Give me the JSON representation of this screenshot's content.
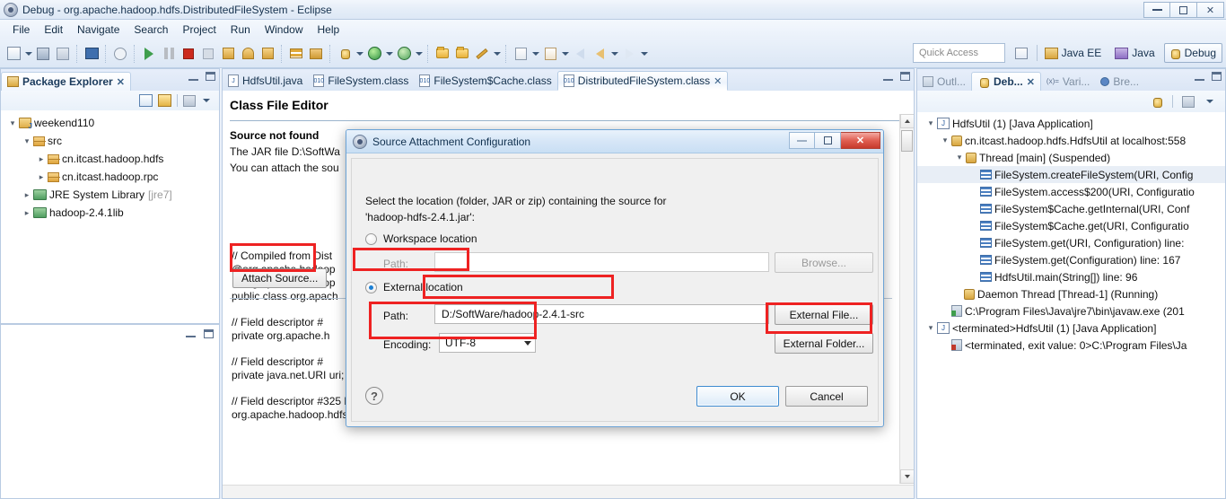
{
  "window": {
    "title": "Debug - org.apache.hadoop.hdfs.DistributedFileSystem - Eclipse",
    "icon": "eclipse-icon",
    "buttons": {
      "minimize": "—",
      "restore": "❐",
      "close": "✕"
    }
  },
  "menubar": {
    "items": [
      {
        "label": "File"
      },
      {
        "label": "Edit"
      },
      {
        "label": "Navigate"
      },
      {
        "label": "Search"
      },
      {
        "label": "Project"
      },
      {
        "label": "Run"
      },
      {
        "label": "Window"
      },
      {
        "label": "Help"
      }
    ]
  },
  "toolbar": {
    "quick_access_placeholder": "Quick Access",
    "perspectives": [
      {
        "label": "Java EE",
        "active": false,
        "icon": "javaee-perspective-icon"
      },
      {
        "label": "Java",
        "active": false,
        "icon": "java-perspective-icon"
      },
      {
        "label": "Debug",
        "active": true,
        "icon": "debug-perspective-icon"
      }
    ],
    "open_perspective_icon": "open-perspective-icon"
  },
  "package_explorer": {
    "tab_label": "Package Explorer",
    "tab_icon": "package-explorer-icon",
    "toolbar_icons": [
      "collapse-all-icon",
      "link-with-editor-icon",
      "view-menu-icon",
      "view-dropdown-icon"
    ],
    "tree": [
      {
        "label": "weekend110",
        "indent": 0,
        "twisty": "expanded",
        "icon": "java-project-icon",
        "suffix": ""
      },
      {
        "label": "src",
        "indent": 1,
        "twisty": "expanded",
        "icon": "source-folder-icon",
        "suffix": ""
      },
      {
        "label": "cn.itcast.hadoop.hdfs",
        "indent": 2,
        "twisty": "collapsed",
        "icon": "package-icon",
        "suffix": ""
      },
      {
        "label": "cn.itcast.hadoop.rpc",
        "indent": 2,
        "twisty": "collapsed",
        "icon": "package-icon",
        "suffix": ""
      },
      {
        "label": "JRE System Library",
        "indent": 1,
        "twisty": "collapsed",
        "icon": "library-icon",
        "suffix": "[jre7]"
      },
      {
        "label": "hadoop-2.4.1lib",
        "indent": 1,
        "twisty": "collapsed",
        "icon": "library-icon",
        "suffix": ""
      }
    ]
  },
  "editor": {
    "tabs": [
      {
        "label": "HdfsUtil.java",
        "icon": "java-file-icon",
        "active": false,
        "closable": false
      },
      {
        "label": "FileSystem.class",
        "icon": "class-file-icon",
        "active": false,
        "closable": false
      },
      {
        "label": "FileSystem$Cache.class",
        "icon": "class-file-icon",
        "active": false,
        "closable": false
      },
      {
        "label": "DistributedFileSystem.class",
        "icon": "class-file-icon",
        "active": true,
        "closable": true
      }
    ],
    "title": "Class File Editor",
    "section_heading": "Source not found",
    "info_lines": [
      "The JAR file D:\\SoftWa",
      "You can attach the sou"
    ],
    "attach_source_button": "Attach Source...",
    "code_lines": [
      "// Compiled from Dist",
      "@org.apache.hadoop",
      "@org.apache.hadoop",
      "public class org.apach",
      "",
      "  // Field descriptor #",
      "  private org.apache.h",
      "",
      "  // Field descriptor #",
      "  private java.net.URI uri;",
      "",
      "  // Field descriptor #325 Lorg/apache/hadoop/hdfs/DFSClient;",
      "  org.apache.hadoop.hdfs.DFSClient dfs;"
    ]
  },
  "debug_view": {
    "tabs": [
      {
        "label": "Outl...",
        "icon": "outline-icon",
        "active": false
      },
      {
        "label": "Deb...",
        "icon": "debug-icon",
        "active": true
      },
      {
        "label": "Vari...",
        "icon": "variables-icon",
        "active": false
      },
      {
        "label": "Bre...",
        "icon": "breakpoints-icon",
        "active": false
      }
    ],
    "toolbar_icons": [
      "debug-icon",
      "view-menu-icon",
      "view-dropdown-icon"
    ],
    "tree": [
      {
        "label": "HdfsUtil (1) [Java Application]",
        "indent": 0,
        "twisty": "expanded",
        "icon": "java-launch-icon",
        "selected": false
      },
      {
        "label": "cn.itcast.hadoop.hdfs.HdfsUtil at localhost:558",
        "indent": 1,
        "twisty": "expanded",
        "icon": "debug-target-icon",
        "selected": false
      },
      {
        "label": "Thread [main] (Suspended)",
        "indent": 2,
        "twisty": "expanded",
        "icon": "thread-icon",
        "selected": false
      },
      {
        "label": "FileSystem.createFileSystem(URI, Config",
        "indent": 3,
        "twisty": "none",
        "icon": "stack-frame-icon",
        "selected": true
      },
      {
        "label": "FileSystem.access$200(URI, Configuratio",
        "indent": 3,
        "twisty": "none",
        "icon": "stack-frame-icon",
        "selected": false
      },
      {
        "label": "FileSystem$Cache.getInternal(URI, Conf",
        "indent": 3,
        "twisty": "none",
        "icon": "stack-frame-icon",
        "selected": false
      },
      {
        "label": "FileSystem$Cache.get(URI, Configuratio",
        "indent": 3,
        "twisty": "none",
        "icon": "stack-frame-icon",
        "selected": false
      },
      {
        "label": "FileSystem.get(URI, Configuration) line:",
        "indent": 3,
        "twisty": "none",
        "icon": "stack-frame-icon",
        "selected": false
      },
      {
        "label": "FileSystem.get(Configuration) line: 167",
        "indent": 3,
        "twisty": "none",
        "icon": "stack-frame-icon",
        "selected": false
      },
      {
        "label": "HdfsUtil.main(String[]) line: 96",
        "indent": 3,
        "twisty": "none",
        "icon": "stack-frame-icon",
        "selected": false
      },
      {
        "label": "Daemon Thread [Thread-1] (Running)",
        "indent": 2,
        "twisty": "none",
        "icon": "thread-running-icon",
        "selected": false
      },
      {
        "label": "C:\\Program Files\\Java\\jre7\\bin\\javaw.exe (201",
        "indent": 1,
        "twisty": "none",
        "icon": "process-icon",
        "selected": false
      },
      {
        "label": "<terminated>HdfsUtil (1) [Java Application]",
        "indent": 0,
        "twisty": "expanded",
        "icon": "java-launch-icon",
        "selected": false
      },
      {
        "label": "<terminated, exit value: 0>C:\\Program Files\\Ja",
        "indent": 1,
        "twisty": "none",
        "icon": "process-terminated-icon",
        "selected": false
      }
    ]
  },
  "dialog": {
    "title": "Source Attachment Configuration",
    "icon": "eclipse-icon",
    "buttons": {
      "minimize": "—",
      "restore": "❐",
      "close": "✕"
    },
    "description_line1": "Select the location (folder, JAR or zip) containing the source for",
    "description_line2": "'hadoop-hdfs-2.4.1.jar':",
    "workspace_option": {
      "label": "Workspace location",
      "selected": false
    },
    "workspace_path": {
      "label": "Path:",
      "value": "",
      "disabled": true
    },
    "browse_button": {
      "label": "Browse...",
      "disabled": true
    },
    "external_option": {
      "label": "External location",
      "selected": true
    },
    "external_path": {
      "label": "Path:",
      "value": "D:/SoftWare/hadoop-2.4.1-src"
    },
    "external_file_button": {
      "label": "External File..."
    },
    "external_folder_button": {
      "label": "External Folder..."
    },
    "encoding": {
      "label": "Encoding:",
      "value": "UTF-8"
    },
    "help_button": "?",
    "ok_button": "OK",
    "cancel_button": "Cancel"
  },
  "annotations": {
    "boxes": [
      {
        "name": "attach-source-highlight"
      },
      {
        "name": "external-location-highlight"
      },
      {
        "name": "path-field-highlight"
      },
      {
        "name": "encoding-highlight"
      },
      {
        "name": "external-folder-highlight"
      }
    ],
    "color": "#ee2222"
  }
}
